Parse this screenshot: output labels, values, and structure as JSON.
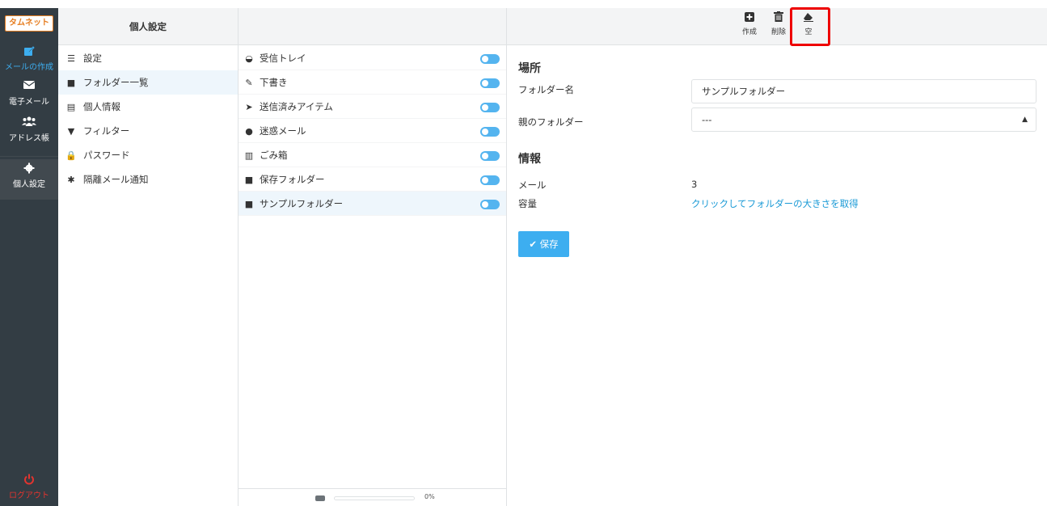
{
  "nav": {
    "logo": "タムネット",
    "compose": "メールの作成",
    "mail": "電子メール",
    "contacts": "アドレス帳",
    "settings": "個人設定",
    "logout": "ログアウト"
  },
  "settings_column": {
    "title": "個人設定",
    "items": [
      {
        "label": "設定",
        "icon": "sliders-icon"
      },
      {
        "label": "フォルダー一覧",
        "icon": "folder-icon",
        "selected": true
      },
      {
        "label": "個人情報",
        "icon": "id-card-icon"
      },
      {
        "label": "フィルター",
        "icon": "filter-icon"
      },
      {
        "label": "パスワード",
        "icon": "lock-icon"
      },
      {
        "label": "隔離メール通知",
        "icon": "gear-icon"
      }
    ]
  },
  "folders": [
    {
      "name": "受信トレイ",
      "icon": "inbox-icon"
    },
    {
      "name": "下書き",
      "icon": "pencil-icon"
    },
    {
      "name": "送信済みアイテム",
      "icon": "paper-plane-icon"
    },
    {
      "name": "迷惑メール",
      "icon": "spam-icon"
    },
    {
      "name": "ごみ箱",
      "icon": "trash-icon"
    },
    {
      "name": "保存フォルダー",
      "icon": "folder-icon"
    },
    {
      "name": "サンプルフォルダー",
      "icon": "folder-icon",
      "selected": true
    }
  ],
  "quota": {
    "percent_text": "0%",
    "fraction": 0
  },
  "toolbar": {
    "create": "作成",
    "delete": "削除",
    "empty": "空"
  },
  "details": {
    "location_title": "場所",
    "folder_name_label": "フォルダー名",
    "folder_name_value": "サンプルフォルダー",
    "parent_label": "親のフォルダー",
    "parent_value": "---",
    "info_title": "情報",
    "mail_label": "メール",
    "mail_value": "3",
    "size_label": "容量",
    "size_link": "クリックしてフォルダーの大きさを取得",
    "save_label": "保存"
  },
  "colors": {
    "accent": "#3daef0",
    "sidebar": "#333d44",
    "highlight": "#e00000",
    "logout": "#e3342f"
  }
}
